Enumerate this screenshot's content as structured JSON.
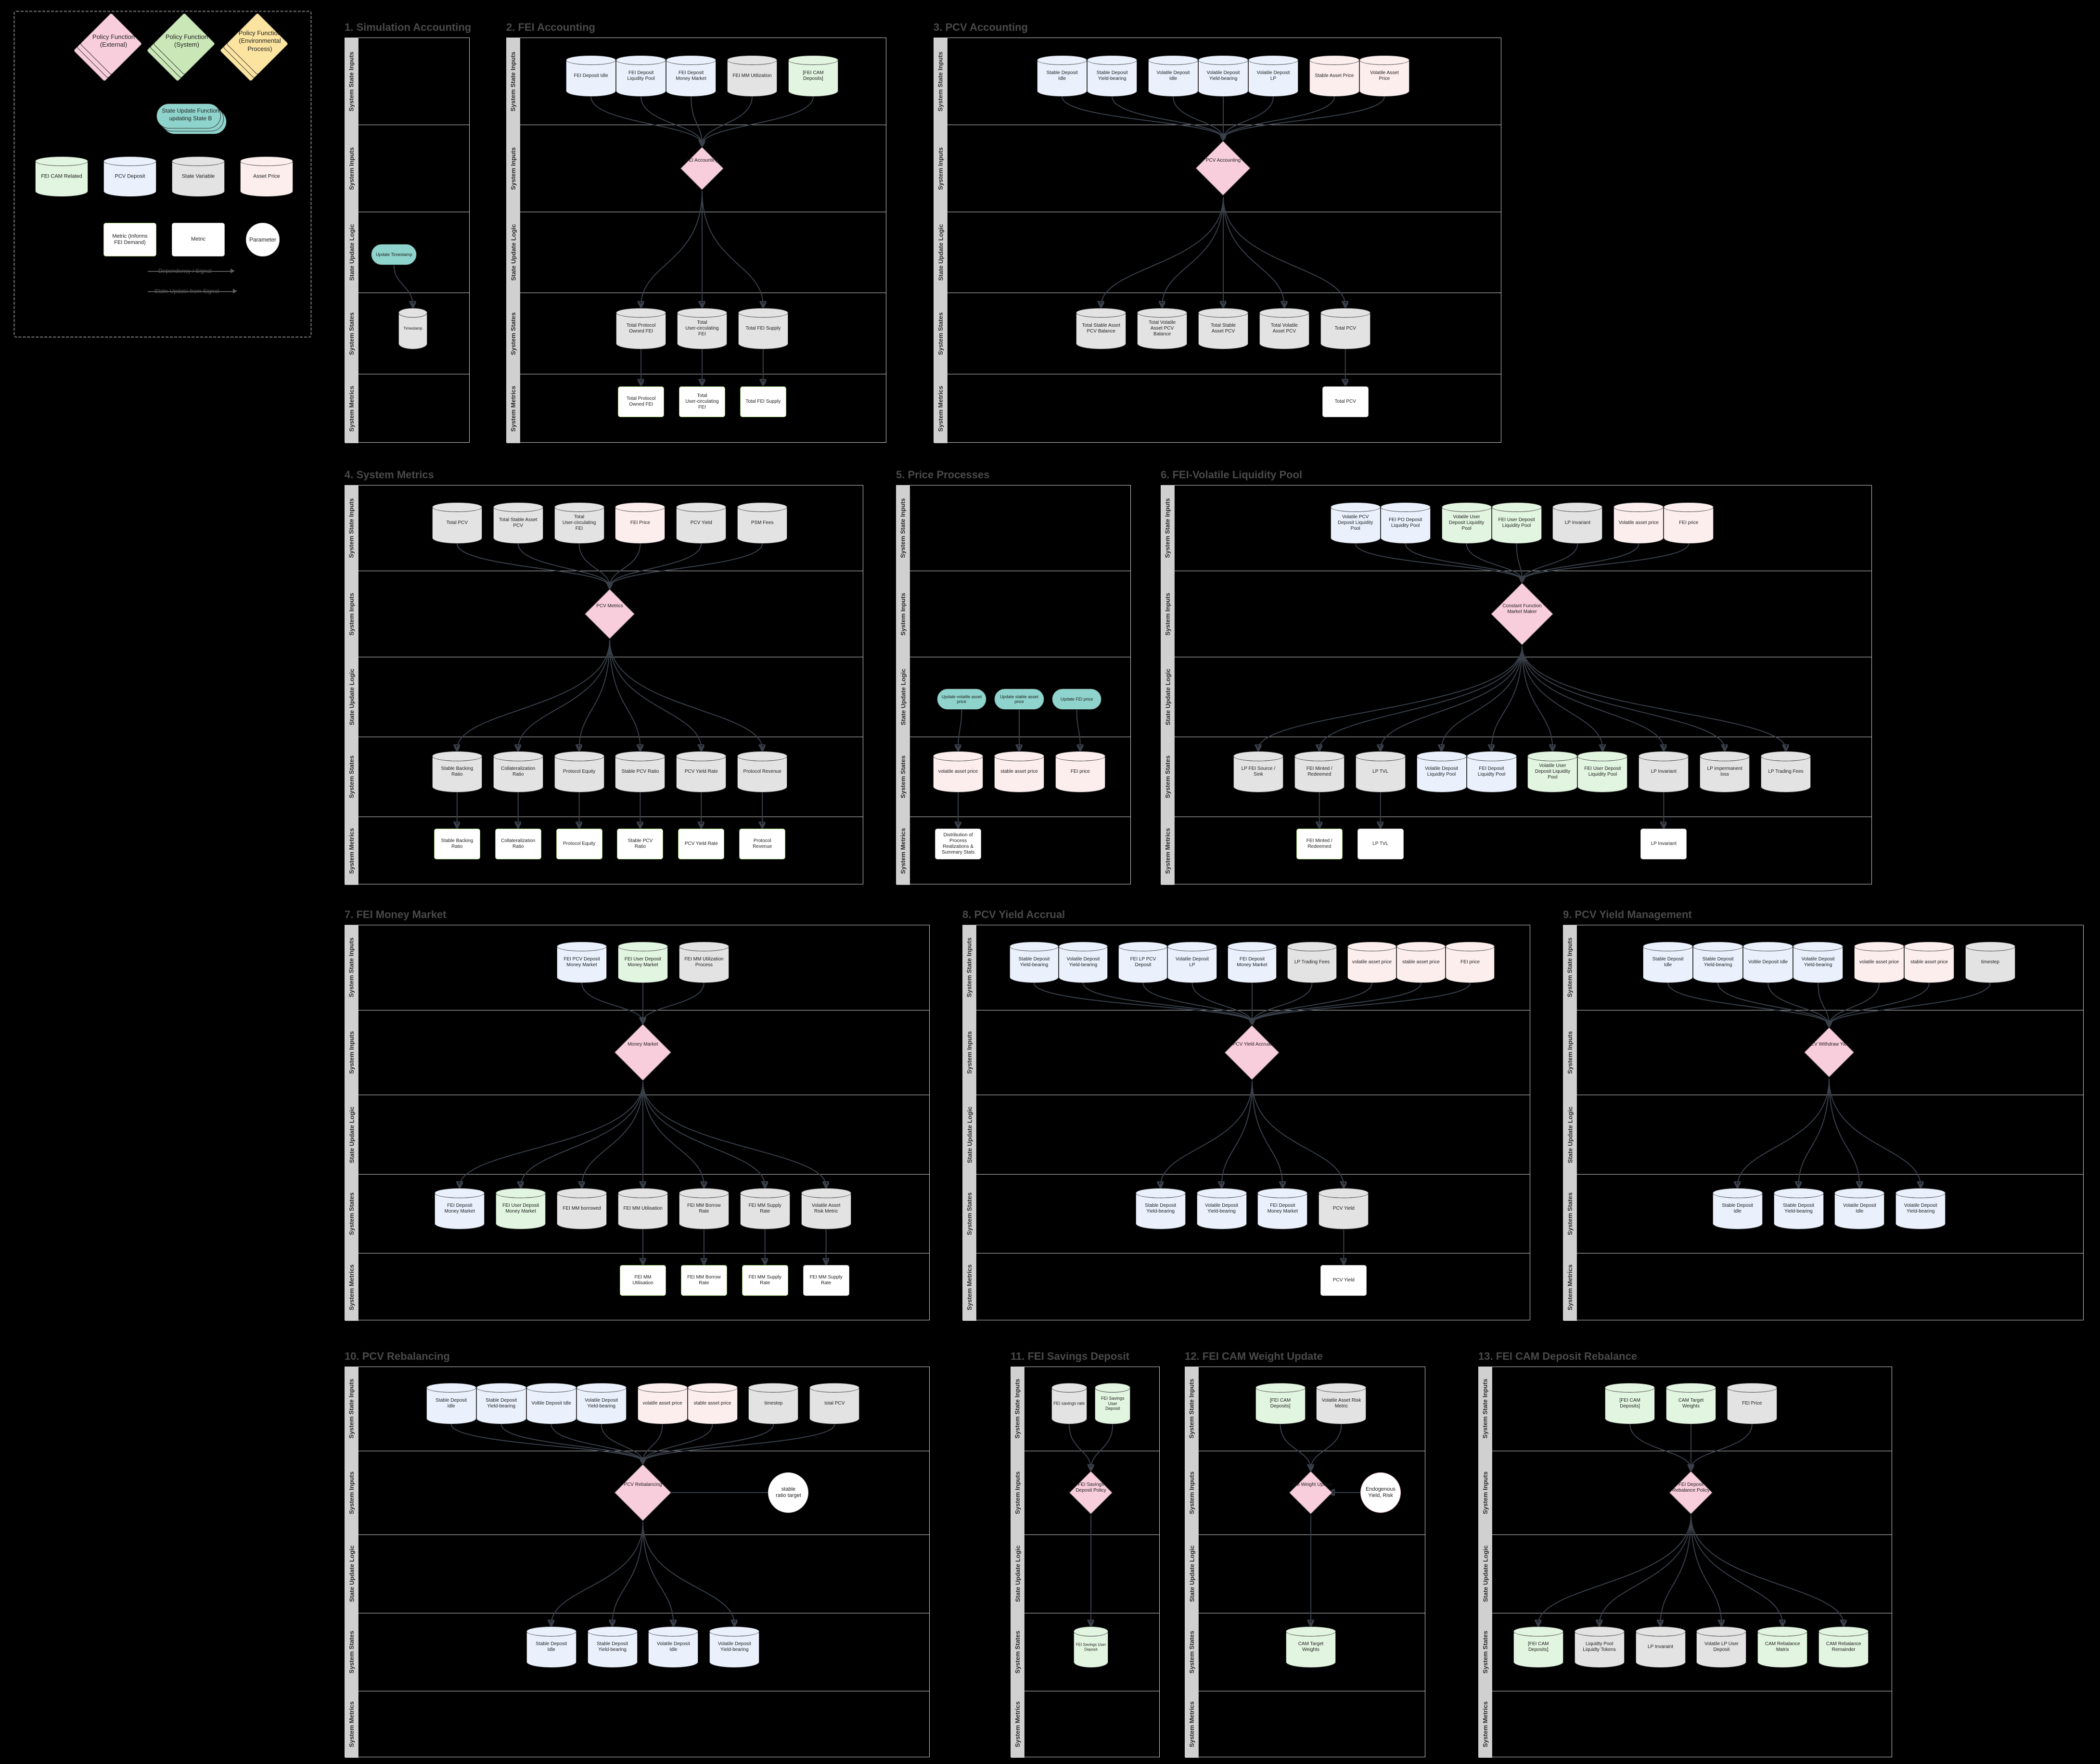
{
  "legend": {
    "policy_external": "Policy Function\n(External)",
    "policy_external_l1": "Policy Function",
    "policy_external_l2": "(External)",
    "policy_system_l1": "Policy Function",
    "policy_system_l2": "(System)",
    "policy_env_l1": "Policy Function",
    "policy_env_l2": "(Environmental",
    "policy_env_l3": "Process)",
    "suf_l1": "State Update Function",
    "suf_l2": "updating State B",
    "cyl_fei_cam": "FEI CAM Related",
    "cyl_pcv_deposit": "PCV Deposit",
    "cyl_state_variable": "State Variable",
    "cyl_asset_price": "Asset Price",
    "metric_fei_l1": "Metric (Informs",
    "metric_fei_l2": "FEI Demand)",
    "metric": "Metric",
    "parameter": "Parameter",
    "arrow_dependency": "Dependency / Signal",
    "arrow_state_update": "State Update from Signal"
  },
  "lanes": [
    "System State Inputs",
    "System Inputs",
    "State Update Logic",
    "System States",
    "System Metrics"
  ],
  "panels": [
    {
      "id": "p1",
      "title": "1. Simulation Accounting",
      "state_inputs": [],
      "policy": null,
      "sufs": [
        {
          "label": "Update Timestamp"
        }
      ],
      "states": [
        {
          "label": "Timestamp",
          "kind": "grey"
        }
      ],
      "metrics": []
    },
    {
      "id": "p2",
      "title": "2. FEI Accounting",
      "state_inputs": [
        {
          "label": "FEI Deposit Idle",
          "kind": "blue",
          "group": 0
        },
        {
          "label": "FEI Deposit\nLiqudity Pool",
          "kind": "blue",
          "group": 0
        },
        {
          "label": "FEI Deposit\nMoney Market",
          "kind": "blue",
          "group": 0
        },
        {
          "label": "FEI MM Utilization",
          "kind": "grey",
          "group": 1
        },
        {
          "label": "[FEI CAM\nDeposits]",
          "kind": "green",
          "group": 2
        }
      ],
      "policy": {
        "label": "FEI Accounting"
      },
      "sufs": [],
      "states": [
        {
          "label": "Total Protocol\nOwned FEI",
          "kind": "grey"
        },
        {
          "label": "Total\nUser-circulating\nFEI",
          "kind": "grey"
        },
        {
          "label": "Total FEI Supply",
          "kind": "grey"
        }
      ],
      "metrics": [
        {
          "label": "Total Protocol\nOwned FEI",
          "fei": true
        },
        {
          "label": "Total\nUser-circulating\nFEI",
          "fei": true
        },
        {
          "label": "Total FEI Supply",
          "fei": true
        }
      ]
    },
    {
      "id": "p3",
      "title": "3. PCV Accounting",
      "state_inputs": [
        {
          "label": "Stable Deposit\nIdle",
          "kind": "blue",
          "group": 0
        },
        {
          "label": "Stable Deposit\nYield-bearing",
          "kind": "blue",
          "group": 0
        },
        {
          "label": "Volatile Deposit\nIdle",
          "kind": "blue",
          "group": 1
        },
        {
          "label": "Volatile Deposit\nYield-bearing",
          "kind": "blue",
          "group": 1
        },
        {
          "label": "Volatile Deposit\nLP",
          "kind": "blue",
          "group": 1
        },
        {
          "label": "Stable Asset Price",
          "kind": "pink",
          "group": 2
        },
        {
          "label": "Volatile Asset\nPrice",
          "kind": "pink",
          "group": 2
        }
      ],
      "policy": {
        "label": "PCV Accounting"
      },
      "sufs": [],
      "states": [
        {
          "label": "Total Stable Asset\nPCV Balance",
          "kind": "grey"
        },
        {
          "label": "Total Volatile\nAsset PCV\nBalance",
          "kind": "grey"
        },
        {
          "label": "Total Stable\nAsset PCV",
          "kind": "grey"
        },
        {
          "label": "Total Volatile\nAsset PCV",
          "kind": "grey"
        },
        {
          "label": "Total PCV",
          "kind": "grey"
        }
      ],
      "metrics": [
        {
          "label": "Total PCV",
          "fei": false,
          "at": 4
        }
      ]
    },
    {
      "id": "p4",
      "title": "4. System Metrics",
      "state_inputs": [
        {
          "label": "Total PCV",
          "kind": "grey",
          "group": 0
        },
        {
          "label": "Total Stable Asset\nPCV",
          "kind": "grey",
          "group": 1
        },
        {
          "label": "Total\nUser-circulating\nFEI",
          "kind": "grey",
          "group": 2
        },
        {
          "label": "FEI Price",
          "kind": "pink",
          "group": 3
        },
        {
          "label": "PCV Yield",
          "kind": "grey",
          "group": 4
        },
        {
          "label": "PSM Fees",
          "kind": "grey",
          "group": 5
        }
      ],
      "policy": {
        "label": "PCV Metrics"
      },
      "sufs": [],
      "states": [
        {
          "label": "Stable Backing\nRatio",
          "kind": "grey"
        },
        {
          "label": "Collateralization\nRatio",
          "kind": "grey"
        },
        {
          "label": "Protocol Equity",
          "kind": "grey"
        },
        {
          "label": "Stable PCV Ratio",
          "kind": "grey"
        },
        {
          "label": "PCV Yield Rate",
          "kind": "grey"
        },
        {
          "label": "Protocol Revenue",
          "kind": "grey"
        }
      ],
      "metrics": [
        {
          "label": "Stable Backing\nRatio",
          "fei": true
        },
        {
          "label": "Collateralization\nRatio",
          "fei": true
        },
        {
          "label": "Protocol Equity",
          "fei": true
        },
        {
          "label": "Stable PCV\nRatio",
          "fei": true
        },
        {
          "label": "PCV Yield Rate",
          "fei": true
        },
        {
          "label": "Protocol\nRevenue",
          "fei": true
        }
      ]
    },
    {
      "id": "p5",
      "title": "5. Price Processes",
      "state_inputs": [],
      "policy": null,
      "sufs": [
        {
          "label": "Update volatile asset\nprice"
        },
        {
          "label": "Update stable asset\nprice"
        },
        {
          "label": "Update FEI price"
        }
      ],
      "states": [
        {
          "label": "volatile asset price",
          "kind": "pink"
        },
        {
          "label": "stable asset price",
          "kind": "pink"
        },
        {
          "label": "FEI price",
          "kind": "pink"
        }
      ],
      "metrics": [
        {
          "label": "Distribution of\nProcess\nRealizations &\nSummary Stats",
          "fei": false,
          "at": 0
        }
      ]
    },
    {
      "id": "p6",
      "title": "6. FEI-Volatile Liquidity Pool",
      "state_inputs": [
        {
          "label": "Volatile PCV\nDeposit Liquidity\nPool",
          "kind": "blue",
          "group": 0
        },
        {
          "label": "FEI PO Deposit\nLiquidity Pool",
          "kind": "blue",
          "group": 0
        },
        {
          "label": "Volatile User\nDeposit Liquidity\nPool",
          "kind": "green",
          "group": 1
        },
        {
          "label": "FEI User Deposit\nLiquidity Pool",
          "kind": "green",
          "group": 1
        },
        {
          "label": "LP Invariant",
          "kind": "grey",
          "group": 2
        },
        {
          "label": "Volatile asset price",
          "kind": "pink",
          "group": 3
        },
        {
          "label": "FEI price",
          "kind": "pink",
          "group": 3
        }
      ],
      "policy": {
        "label": "Constant Function\nMarket Maker"
      },
      "sufs": [],
      "states": [
        {
          "label": "LP FEI Source /\nSink",
          "kind": "grey",
          "group": 0
        },
        {
          "label": "FEI Minted /\nRedeemed",
          "kind": "grey",
          "group": 1
        },
        {
          "label": "LP TVL",
          "kind": "grey",
          "group": 2
        },
        {
          "label": "Volatile Deposit\nLiquidity Pool",
          "kind": "blue",
          "group": 3
        },
        {
          "label": "FEI Deposit\nLiquidty Pool",
          "kind": "blue",
          "group": 3
        },
        {
          "label": "Volatile User\nDeposit Liquidity\nPool",
          "kind": "green",
          "group": 4
        },
        {
          "label": "FEI User Deposit\nLiquidity Pool",
          "kind": "green",
          "group": 4
        },
        {
          "label": "LP Invariant",
          "kind": "grey",
          "group": 5
        },
        {
          "label": "LP impermanent\nloss",
          "kind": "grey",
          "group": 6
        },
        {
          "label": "LP Trading Fees",
          "kind": "grey",
          "group": 7
        }
      ],
      "metrics": [
        {
          "label": "FEI Minted /\nRedeemed",
          "fei": true,
          "at": 1
        },
        {
          "label": "LP TVL",
          "fei": false,
          "at": 2
        },
        {
          "label": "LP Invariant",
          "fei": false,
          "at": 7
        }
      ]
    },
    {
      "id": "p7",
      "title": "7. FEI Money Market",
      "state_inputs": [
        {
          "label": "FEI PCV Deposit\nMoney Market",
          "kind": "blue",
          "group": 0
        },
        {
          "label": "FEI User Deposit\nMoney Market",
          "kind": "green",
          "group": 1
        },
        {
          "label": "FEI MM Utilization\nProcess",
          "kind": "grey",
          "group": 2
        }
      ],
      "policy": {
        "label": "Money Market"
      },
      "sufs": [],
      "states": [
        {
          "label": "FEI Deposit\nMoney Market",
          "kind": "blue"
        },
        {
          "label": "FEI User Deposit\nMoney Market",
          "kind": "green"
        },
        {
          "label": "FEI MM borrowed",
          "kind": "grey"
        },
        {
          "label": "FEI MM Utilisation",
          "kind": "grey"
        },
        {
          "label": "FEI MM Borrow\nRate",
          "kind": "grey"
        },
        {
          "label": "FEI MM Supply\nRate",
          "kind": "grey"
        },
        {
          "label": "Volatile Asset\nRisk Metric",
          "kind": "grey"
        }
      ],
      "metrics": [
        {
          "label": "FEI MM\nUtilisation",
          "fei": true,
          "at": 3
        },
        {
          "label": "FEI MM Borrow\nRate",
          "fei": true,
          "at": 4
        },
        {
          "label": "FEI MM Supply\nRate",
          "fei": true,
          "at": 5
        },
        {
          "label": "FEI MM Supply\nRate",
          "fei": false,
          "at": 6
        }
      ]
    },
    {
      "id": "p8",
      "title": "8. PCV Yield Accrual",
      "state_inputs": [
        {
          "label": "Stable Deposit\nYield-bearing",
          "kind": "blue",
          "group": 0
        },
        {
          "label": "Volatile Deposit\nYield-bearing",
          "kind": "blue",
          "group": 0
        },
        {
          "label": "FEI LP PCV\nDeposit",
          "kind": "blue",
          "group": 1
        },
        {
          "label": "Volatile Deposit\nLP",
          "kind": "blue",
          "group": 1
        },
        {
          "label": "FEI Deposit\nMoney Market",
          "kind": "blue",
          "group": 2
        },
        {
          "label": "LP Trading Fees",
          "kind": "grey",
          "group": 3
        },
        {
          "label": "volatile asset price",
          "kind": "pink",
          "group": 4
        },
        {
          "label": "stable asset price",
          "kind": "pink",
          "group": 4
        },
        {
          "label": "FEI price",
          "kind": "pink",
          "group": 4
        }
      ],
      "policy": {
        "label": "PCV Yield Accrual"
      },
      "sufs": [],
      "states": [
        {
          "label": "Stable Deposit\nYield-bearing",
          "kind": "blue"
        },
        {
          "label": "Volatile Deposit\nYield-bearing",
          "kind": "blue"
        },
        {
          "label": "FEI Deposit\nMoney Market",
          "kind": "blue"
        },
        {
          "label": "PCV Yield",
          "kind": "grey"
        }
      ],
      "metrics": [
        {
          "label": "PCV Yield",
          "fei": false,
          "at": 3
        }
      ]
    },
    {
      "id": "p9",
      "title": "9. PCV Yield Management",
      "state_inputs": [
        {
          "label": "Stable Deposit\nIdle",
          "kind": "blue",
          "group": 0
        },
        {
          "label": "Stable Deposit\nYield-bearing",
          "kind": "blue",
          "group": 0
        },
        {
          "label": "Voltile Deposit Idle",
          "kind": "blue",
          "group": 0
        },
        {
          "label": "Volatile Deposit\nYield-bearing",
          "kind": "blue",
          "group": 0
        },
        {
          "label": "volatile asset price",
          "kind": "pink",
          "group": 1
        },
        {
          "label": "stable asset price",
          "kind": "pink",
          "group": 1
        },
        {
          "label": "timestep",
          "kind": "grey",
          "group": 2
        }
      ],
      "policy": {
        "label": "PCV  Withdraw Yield"
      },
      "sufs": [],
      "states": [
        {
          "label": "Stable Deposit\nIdle",
          "kind": "blue"
        },
        {
          "label": "Stable Deposit\nYield-bearing",
          "kind": "blue"
        },
        {
          "label": "Volatile Deposit\nIdle",
          "kind": "blue"
        },
        {
          "label": "Volatile Deposit\nYield-bearing",
          "kind": "blue"
        }
      ],
      "metrics": []
    },
    {
      "id": "p10",
      "title": "10. PCV Rebalancing",
      "state_inputs": [
        {
          "label": "Stable Deposit\nIdle",
          "kind": "blue",
          "group": 0
        },
        {
          "label": "Stable Deposit\nYield-bearing",
          "kind": "blue",
          "group": 0
        },
        {
          "label": "Voltile Deposit Idle",
          "kind": "blue",
          "group": 0
        },
        {
          "label": "Volatile Deposit\nYield-bearing",
          "kind": "blue",
          "group": 0
        },
        {
          "label": "volatile asset price",
          "kind": "pink",
          "group": 1
        },
        {
          "label": "stable asset price",
          "kind": "pink",
          "group": 1
        },
        {
          "label": "timestep",
          "kind": "grey",
          "group": 2
        },
        {
          "label": "total PCV",
          "kind": "grey",
          "group": 3
        }
      ],
      "policy": {
        "label": "PCV Rebalancing"
      },
      "parameter": {
        "label": "stable\nratio target"
      },
      "sufs": [],
      "states": [
        {
          "label": "Stable Deposit\nIdle",
          "kind": "blue"
        },
        {
          "label": "Stable Deposit\nYield-bearing",
          "kind": "blue"
        },
        {
          "label": "Volatile Deposit\nIdle",
          "kind": "blue"
        },
        {
          "label": "Volatile Deposit\nYield-bearing",
          "kind": "blue"
        }
      ],
      "metrics": []
    },
    {
      "id": "p11",
      "title": "11. FEI Savings Deposit",
      "state_inputs": [
        {
          "label": "FEI savings rate",
          "kind": "grey",
          "group": 0
        },
        {
          "label": "FEI Savings User\nDeposit",
          "kind": "green",
          "group": 1
        }
      ],
      "policy": {
        "label": "FEI Savings\nDeposit Policy"
      },
      "sufs": [],
      "states": [
        {
          "label": "FEI Savings User\nDeposit",
          "kind": "green"
        }
      ],
      "metrics": []
    },
    {
      "id": "p12",
      "title": "12. FEI CAM Weight Update",
      "state_inputs": [
        {
          "label": "[FEI CAM\nDeposits]",
          "kind": "green",
          "group": 0
        },
        {
          "label": "Volatile Asset Risk\nMetric",
          "kind": "grey",
          "group": 1
        }
      ],
      "policy": {
        "label": "CAM Weight Update"
      },
      "parameter": {
        "label": "Endogenous\nYield, Risk",
        "pinkring": true
      },
      "sufs": [],
      "states": [
        {
          "label": "CAM Target\nWeights",
          "kind": "green"
        }
      ],
      "metrics": []
    },
    {
      "id": "p13",
      "title": "13. FEI CAM Deposit Rebalance",
      "state_inputs": [
        {
          "label": "[FEI CAM\nDeposits]",
          "kind": "green",
          "group": 0
        },
        {
          "label": "CAM Target\nWeights",
          "kind": "green",
          "group": 1
        },
        {
          "label": "FEI Price",
          "kind": "grey",
          "group": 2
        }
      ],
      "policy": {
        "label": "FEI Deposit\nRebalance Policy"
      },
      "sufs": [],
      "states": [
        {
          "label": "[FEI CAM\nDeposits]",
          "kind": "green"
        },
        {
          "label": "Liquidty Pool\nLiquidty Tokens",
          "kind": "grey"
        },
        {
          "label": "LP Invaraint",
          "kind": "grey"
        },
        {
          "label": "Volatile LP User\nDeposit",
          "kind": "grey"
        },
        {
          "label": "CAM Rebalance\nMatrix",
          "kind": "green"
        },
        {
          "label": "CAM Rebalance\nRemainder",
          "kind": "green"
        }
      ],
      "metrics": []
    }
  ]
}
